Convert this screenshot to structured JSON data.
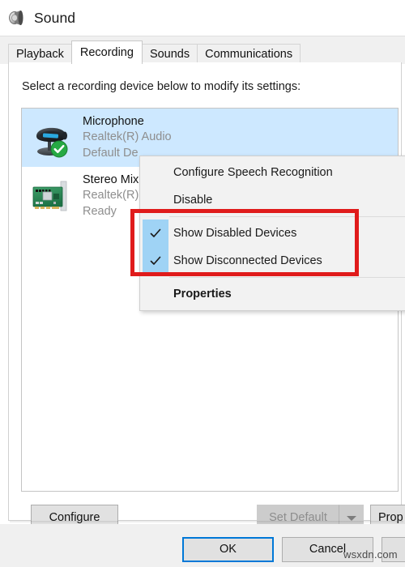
{
  "window": {
    "title": "Sound",
    "icon": "speaker-icon"
  },
  "tabs": [
    {
      "label": "Playback",
      "active": false
    },
    {
      "label": "Recording",
      "active": true
    },
    {
      "label": "Sounds",
      "active": false
    },
    {
      "label": "Communications",
      "active": false
    }
  ],
  "main": {
    "instruction": "Select a recording device below to modify its settings:"
  },
  "devices": [
    {
      "name": "Microphone",
      "driver": "Realtek(R) Audio",
      "status": "Default De",
      "icon": "microphone-icon",
      "badge": "green-check-icon",
      "selected": true
    },
    {
      "name": "Stereo Mix",
      "driver": "Realtek(R)",
      "status": "Ready",
      "icon": "sound-card-icon",
      "badge": "",
      "selected": false
    }
  ],
  "page_buttons": {
    "configure": "Configure",
    "set_default": "Set Default",
    "set_default_dropdown": "chevron-down-icon",
    "properties": "Prop"
  },
  "dialog_buttons": {
    "ok": "OK",
    "cancel": "Cancel",
    "apply": ""
  },
  "context_menu": {
    "items": [
      {
        "label": "Configure Speech Recognition",
        "checked": false,
        "bold": false
      },
      {
        "label": "Disable",
        "checked": false,
        "bold": false
      },
      {
        "label": "Show Disabled Devices",
        "checked": true,
        "bold": false
      },
      {
        "label": "Show Disconnected Devices",
        "checked": true,
        "bold": false
      },
      {
        "label": "Properties",
        "checked": false,
        "bold": true
      }
    ]
  },
  "annotation": {
    "color": "#e01b1b",
    "highlights": [
      "Show Disabled Devices",
      "Show Disconnected Devices"
    ]
  },
  "watermark": {
    "text": "wsxdn.com"
  },
  "colors": {
    "selection": "#cde8ff",
    "check_gutter": "#9fd3f5",
    "focus_border": "#0078d7",
    "annotation_red": "#e01b1b",
    "dialog_chrome": "#f0f0f0"
  }
}
